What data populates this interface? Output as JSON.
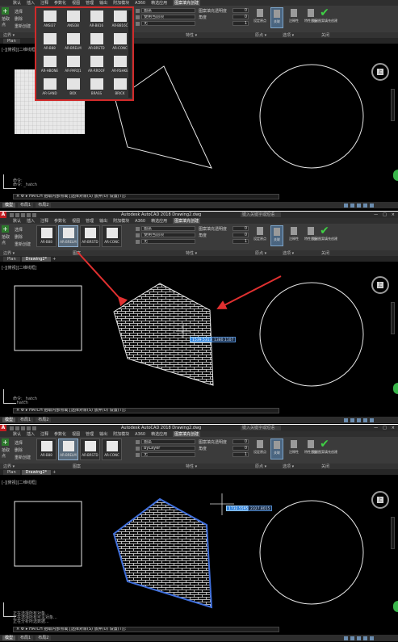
{
  "app": {
    "title": "Autodesk AutoCAD 2018    Drawing2.dwg",
    "search_placeholder": "键入关键字或短语",
    "logo": "A",
    "window_buttons": [
      "—",
      "□",
      "×"
    ]
  },
  "menu": [
    "默认",
    "插入",
    "注释",
    "参数化",
    "视图",
    "管理",
    "输出",
    "附加模块",
    "A360",
    "精选应用",
    "BIM 360",
    "Performance",
    "图案填充创建"
  ],
  "ribbon": {
    "boundary_labels": [
      "拾取点",
      "选择",
      "删除",
      "重新创建"
    ],
    "add_label": "拾取点",
    "patterns_row": [
      "AR-B88",
      "AR-BRELM",
      "AR-BRSTD",
      "AR-CONC"
    ],
    "patterns_row_top": [
      "ANSI37",
      "ANSI38",
      "AR-B816",
      "AR-B816C"
    ],
    "props_panel1": {
      "type": "图案",
      "color": "使用当前项",
      "color3": "ByLayer",
      "background": "无",
      "transparency_label": "图案填充透明度",
      "transparency_value": "0",
      "angle_label": "角度",
      "angle_value": "0",
      "scale_value": "1"
    },
    "tools": [
      {
        "label": "设定原点",
        "on": false
      },
      {
        "label": "关联",
        "on": true
      },
      {
        "label": "注释性",
        "on": false
      },
      {
        "label": "特性匹配",
        "on": false
      }
    ],
    "close_label": "关闭图案填充创建",
    "groups": [
      "边界 ▾",
      "图案",
      "特性 ▾",
      "原点 ▾",
      "选项 ▾",
      "关闭"
    ]
  },
  "popup_patterns": [
    "ANSI37",
    "ANSI38",
    "AR-B816",
    "AR-B816C",
    "AR-B88",
    "AR-BRELM",
    "AR-BRSTD",
    "AR-CONC",
    "AR-HBONE",
    "AR-PARQ1",
    "AR-RROOF",
    "AR-RSHKE",
    "AR-SAND",
    "BOX",
    "BRASS",
    "BRICK"
  ],
  "tabs": [
    "Plan",
    "Drawing2*"
  ],
  "tab_plus": "+",
  "view_label": "[-][俯视][二维线框]",
  "viewcube": {
    "face": "上",
    "letters": [
      "北",
      "南",
      "西",
      "东"
    ],
    "wcs": "WCS"
  },
  "command": {
    "prompt1": "× ⚙ ▸ HATCH 拾取内部点或 [选择对象(S) 放弃(U) 设置(T)]:",
    "history1": [
      "命令:",
      "命令: _hatch"
    ],
    "prompt2": "× ⚙ ▸ HATCH 拾取内部点或 [选择对象(S) 放弃(U) 设置(T)]:",
    "history2": [
      "命令: _hatch",
      "...hatch"
    ],
    "prompt3": "× ⚙ ▸ HATCH 拾取内部点或 [选择对象(S) 放弃(U) 设置(T)]:",
    "history3": [
      "正在选择所有对象...",
      "正在选择所有可见对象...",
      "正在分析所选数据..."
    ]
  },
  "status_tabs": [
    "模型",
    "布局1",
    "布局2",
    "+"
  ],
  "coords": {
    "p2a": "1539.5313",
    "p2b": "1380.1107",
    "p3a": "1732.5595",
    "p3b": "2327.8015"
  },
  "colors": {
    "accent_blue": "#2f80d8",
    "green": "#39b54a",
    "highlight_red": "#d12a2a",
    "arrow_red": "#e03030",
    "selected_blue": "#3f6fdc"
  }
}
